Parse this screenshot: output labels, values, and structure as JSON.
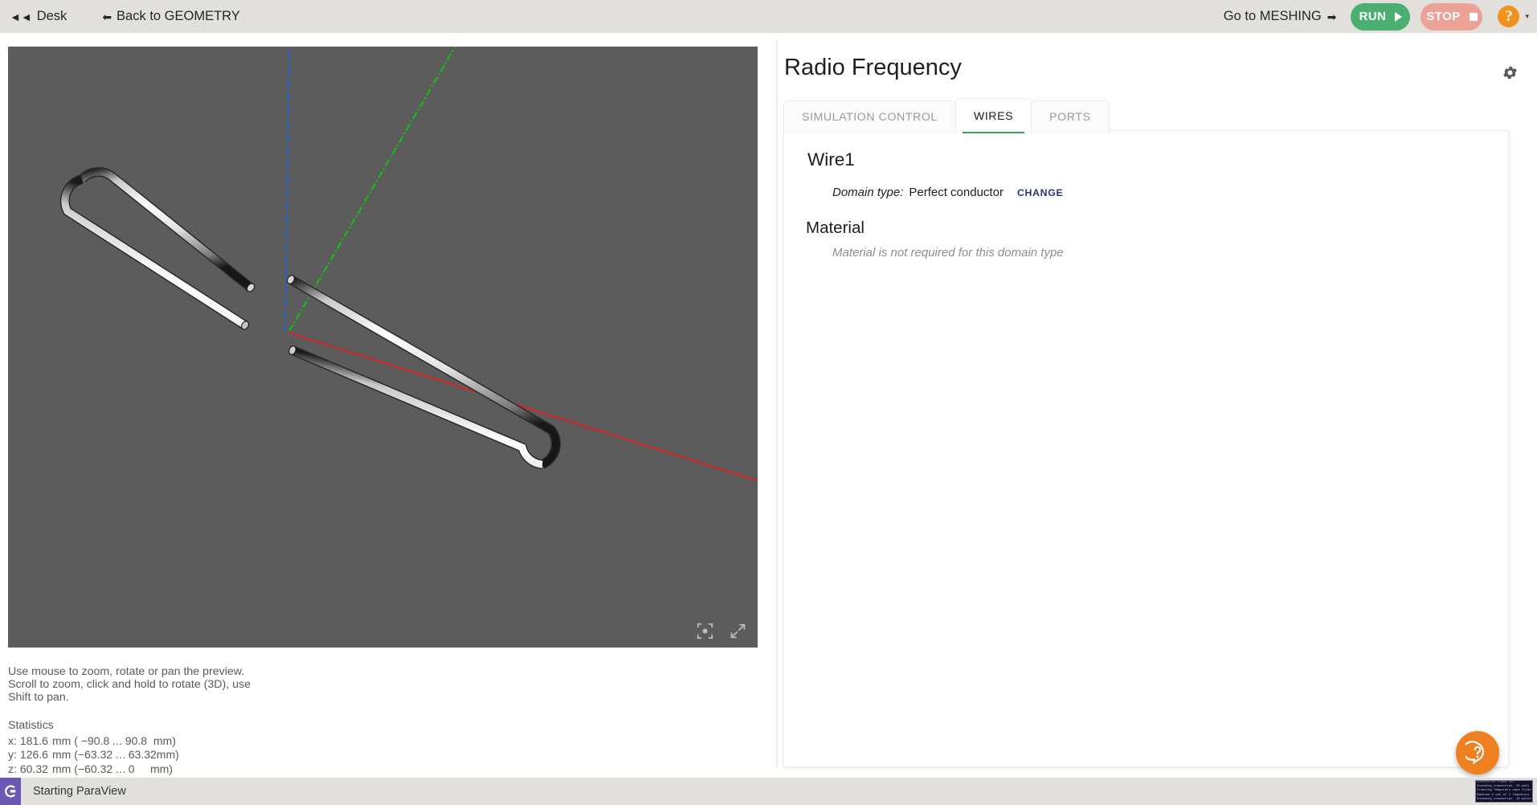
{
  "topbar": {
    "desk_label": "Desk",
    "desk_icon": "double-arrow-left-icon",
    "back_label": "Back to GEOMETRY",
    "back_icon": "arrow-left-icon",
    "goto_label": "Go to MESHING",
    "goto_icon": "arrow-right-icon",
    "run_label": "RUN",
    "stop_label": "STOP",
    "help_label": "?",
    "caret": "▾",
    "colors": {
      "run_bg": "#4caf72",
      "stop_bg": "#eda297",
      "help_bg": "#f0931e",
      "bar_bg": "#e2e0dd"
    }
  },
  "viewport": {
    "background": "#5c5c5c",
    "axes": [
      {
        "name": "x-axis",
        "color": "#e02020",
        "style": "solid"
      },
      {
        "name": "y-axis",
        "color": "#0fc40f",
        "style": "dash-dot"
      },
      {
        "name": "z-axis",
        "color": "#1466d8",
        "style": "dash-dot"
      }
    ],
    "geometry_label": "folded-dipole-wire-loops",
    "tools": [
      {
        "name": "recenter-view-icon"
      },
      {
        "name": "fullscreen-icon"
      }
    ]
  },
  "hint": {
    "line1": "Use mouse to zoom, rotate or pan the preview.",
    "line2": "Scroll to zoom, click and hold to rotate (3D), use",
    "line3": "Shift to pan."
  },
  "statistics": {
    "title": "Statistics",
    "rows": [
      {
        "axis": "x:",
        "size": "181.6",
        "unit": "mm",
        "range": "( −90.8 … 90.8  mm)"
      },
      {
        "axis": "y:",
        "size": "126.6",
        "unit": "mm",
        "range": "(−63.32 … 63.32mm)"
      },
      {
        "axis": "z:",
        "size": "60.32",
        "unit": "mm",
        "range": "(−60.32 … 0     mm)"
      }
    ]
  },
  "panel": {
    "title": "Radio Frequency",
    "settings_icon": "gear-icon",
    "tabs": [
      {
        "label": "SIMULATION CONTROL",
        "active": false
      },
      {
        "label": "WIRES",
        "active": true
      },
      {
        "label": "PORTS",
        "active": false
      }
    ],
    "wire": {
      "name": "Wire1",
      "domain_label": "Domain type:",
      "domain_value": "Perfect conductor",
      "change_label": "CHANGE"
    },
    "material": {
      "heading": "Material",
      "note": "Material is not required for this domain type"
    },
    "accent_color": "#3aa05a"
  },
  "fab": {
    "name": "help-fab",
    "icon": "question-speech-bubble-icon",
    "color": "#ef8022"
  },
  "statusbar": {
    "app_icon": "paraview-app-icon",
    "message": "Starting ParaView",
    "thumbnail": {
      "name": "console-thumbnail",
      "lines": [
        "Connection timed out",
        "Incoming connection. ID walc",
        "Creating Temporary case folde",
        "Removed 0 out of 1 Temporary",
        "Incoming connection. ID walco"
      ]
    }
  }
}
